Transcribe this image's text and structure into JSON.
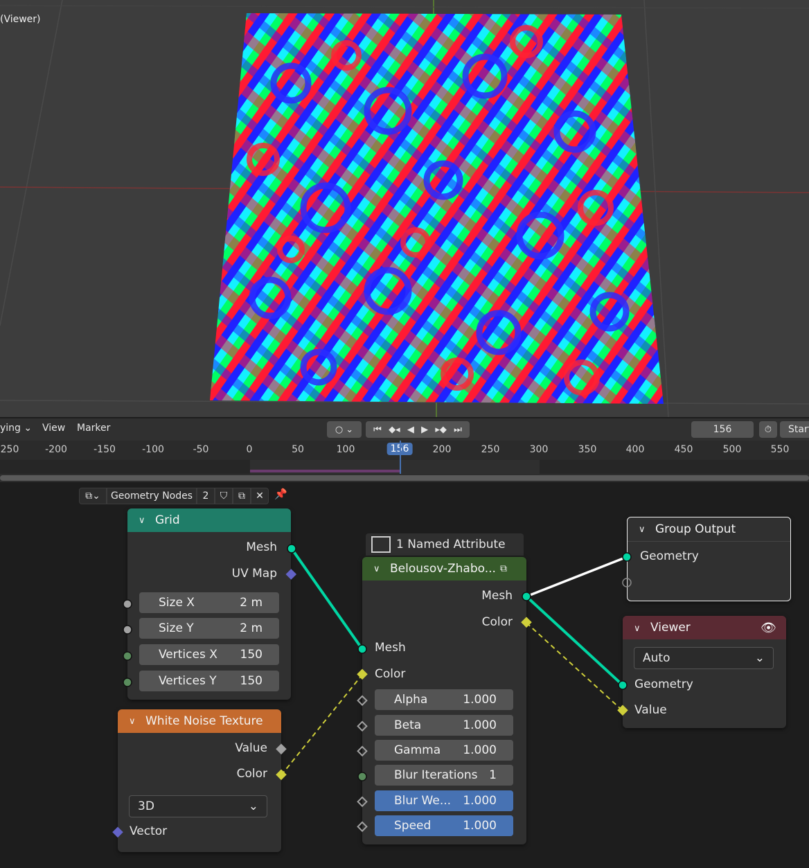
{
  "viewport": {
    "label": "(Viewer)"
  },
  "timeline": {
    "playback_menu": "ying",
    "view_menu": "View",
    "marker_menu": "Marker",
    "current_frame": "156",
    "start_label": "Start",
    "ruler_ticks": [
      "250",
      "-200",
      "-150",
      "-100",
      "-50",
      "0",
      "50",
      "100",
      "156",
      "200",
      "250",
      "300",
      "350",
      "400",
      "450",
      "500",
      "550"
    ],
    "controls": [
      "jump-start-icon",
      "prev-keyframe-icon",
      "play-reverse-icon",
      "play-icon",
      "next-keyframe-icon",
      "jump-end-icon"
    ]
  },
  "node_header": {
    "tree_name": "Geometry Nodes",
    "users": "2"
  },
  "colors": {
    "geometry_socket": "#00d6a3",
    "field_socket": "#cfcf3a",
    "int_socket": "#598c5c",
    "vector_socket": "#6363c7",
    "float_socket": "#a1a1a1",
    "grid_header": "#1f7d68",
    "texture_header": "#c46a2e",
    "group_header": "#365a2a",
    "viewer_header": "#5a2a33",
    "output_header": "#303030"
  },
  "nodes": {
    "grid": {
      "title": "Grid",
      "outputs": [
        "Mesh",
        "UV Map"
      ],
      "fields": [
        {
          "label": "Size X",
          "value": "2 m"
        },
        {
          "label": "Size Y",
          "value": "2 m"
        },
        {
          "label": "Vertices X",
          "value": "150"
        },
        {
          "label": "Vertices Y",
          "value": "150"
        }
      ]
    },
    "noise": {
      "title": "White Noise Texture",
      "outputs": [
        "Value",
        "Color"
      ],
      "dimension": "3D",
      "input": "Vector"
    },
    "group": {
      "frame_label": "1 Named Attribute",
      "title": "Belousov-Zhabo...",
      "outputs": [
        "Mesh",
        "Color"
      ],
      "inputs": [
        "Mesh",
        "Color"
      ],
      "fields": [
        {
          "label": "Alpha",
          "value": "1.000"
        },
        {
          "label": "Beta",
          "value": "1.000"
        },
        {
          "label": "Gamma",
          "value": "1.000"
        },
        {
          "label": "Blur Iterations",
          "value": "1"
        },
        {
          "label": "Blur We...",
          "value": "1.000"
        },
        {
          "label": "Speed",
          "value": "1.000"
        }
      ]
    },
    "output": {
      "title": "Group Output",
      "input": "Geometry"
    },
    "viewer": {
      "title": "Viewer",
      "domain": "Auto",
      "inputs": [
        "Geometry",
        "Value"
      ]
    }
  }
}
